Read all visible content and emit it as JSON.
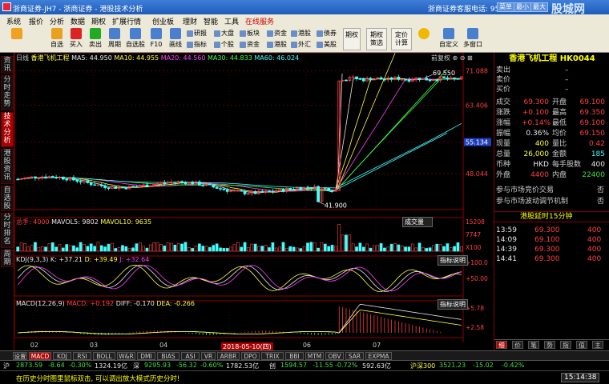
{
  "window": {
    "title": "浙商证券-JH7 - 浙商证券 - 港股技术分析",
    "phone": "浙商证券客服电话: 95345",
    "window_buttons": [
      "菜单",
      "最小",
      "最大",
      "关闭"
    ],
    "watermark": "股城网"
  },
  "menu": [
    "系统",
    "报价",
    "分析",
    "数据",
    "期权",
    "扩展行情",
    "创业板",
    "理财",
    "智能",
    "工具",
    "在线服务"
  ],
  "toolbar": {
    "large": [
      {
        "label": "",
        "icon": "back-arrow-icon",
        "color": "#f2a020"
      },
      {
        "label": "自选",
        "icon": "star-icon",
        "color": "#e8a020"
      },
      {
        "label": "买入",
        "icon": "buy-icon",
        "color": "#d22"
      },
      {
        "label": "卖出",
        "icon": "sell-icon",
        "color": "#2a2"
      },
      {
        "label": "周期",
        "icon": "period-icon",
        "color": "#4a7fd0"
      },
      {
        "label": "自选股",
        "icon": "list-icon",
        "color": "#4a7fd0"
      },
      {
        "label": "F10",
        "icon": "f10-icon",
        "color": "#4a7fd0"
      },
      {
        "label": "画线",
        "icon": "pencil-icon",
        "color": "#4a7fd0"
      }
    ],
    "small": [
      "研报",
      "指标",
      "大盘",
      "个股",
      "板块",
      "资金",
      "港股",
      "外汇",
      "债券",
      "美股"
    ],
    "boxes": [
      "期权",
      "期权\n策选",
      "定价\n计算"
    ],
    "extra": [
      "",
      "自定义",
      "多窗口"
    ]
  },
  "left_tabs": [
    "资讯",
    "分时走势",
    "技术分析",
    "港股资讯",
    "自选股",
    "分时排名",
    "周期"
  ],
  "chart_info": {
    "label": "日线",
    "name": "香港飞机工程",
    "ma_labels": [
      {
        "text": "MA5: 44.950",
        "color": "#e8e8e8"
      },
      {
        "text": "MA10: 44.955",
        "color": "#ffff40"
      },
      {
        "text": "MA20: 44.560",
        "color": "#ff40ff"
      },
      {
        "text": "MA30: 44.833",
        "color": "#40ff40"
      },
      {
        "text": "MA60: 46.024",
        "color": "#40ffff"
      }
    ],
    "right_tags": [
      "前复权",
      "⊕",
      "⊖",
      "⊠"
    ],
    "vol_labels": [
      {
        "text": "总手: 4000",
        "color": "#ff4040"
      },
      {
        "text": "MAVOL5: 9802",
        "color": "#e8e8e8"
      },
      {
        "text": "MAVOL10: 9635",
        "color": "#ffff40"
      }
    ],
    "vol_select": "成交量",
    "kdj_labels": [
      {
        "text": "KDJ(9,3,3)",
        "color": "#e8e8e8"
      },
      {
        "text": "K: +37.21",
        "color": "#e8e8e8"
      },
      {
        "text": "D: +39.49",
        "color": "#ffff40"
      },
      {
        "text": "J: +32.64",
        "color": "#ff40ff"
      }
    ],
    "macd_labels": [
      {
        "text": "MACD(12,26,9)",
        "color": "#e8e8e8"
      },
      {
        "text": "MACD: +0.192",
        "color": "#ff4040"
      },
      {
        "text": "DIFF: -0.170",
        "color": "#e8e8e8"
      },
      {
        "text": "DEA: -0.266",
        "color": "#ffff40"
      }
    ],
    "indicator_btn": "指标说明",
    "date_highlight": "2018-05-10(四)"
  },
  "chart_data": {
    "type": "candlestick",
    "x_month_labels": [
      {
        "label": "02",
        "idx": 5
      },
      {
        "label": "03",
        "idx": 22
      },
      {
        "label": "04",
        "idx": 42
      },
      {
        "label": "05",
        "idx": 61
      },
      {
        "label": "06",
        "idx": 83
      },
      {
        "label": "07",
        "idx": 103
      }
    ],
    "n": 128,
    "y_price_ticks": [
      71.088,
      63.406,
      55.134,
      48.044
    ],
    "y_price_range": [
      40.0,
      73.0
    ],
    "current_price_tag": "55.134",
    "annotations": [
      {
        "text": "69.550",
        "idx": 117,
        "price": 69.55
      },
      {
        "text": "41.900",
        "idx": 86,
        "price": 41.9
      }
    ],
    "price_start": 46.8,
    "price_drop_low": 41.9,
    "price_jump_idx": 92,
    "price_after": 69.3,
    "volume_ticks": [
      "15208",
      "7747",
      "X100"
    ],
    "kdj_ticks": [
      "100.0",
      "50.00"
    ],
    "macd_ticks": [
      "5.78",
      "2.58"
    ]
  },
  "quote": {
    "title": "香港飞机工程  HK0044",
    "bids": [
      {
        "l": "卖出",
        "v": "–"
      },
      {
        "l": "卖价",
        "v": "–"
      },
      {
        "l": "买价",
        "v": "–"
      }
    ],
    "rows": [
      {
        "l1": "成交",
        "v1": "69.300",
        "c1": "#ff4040",
        "l2": "开盘",
        "v2": "69.100",
        "c2": "#ff4040"
      },
      {
        "l1": "涨跌",
        "v1": "+0.100",
        "c1": "#ff4040",
        "l2": "最高",
        "v2": "69.350",
        "c2": "#ff4040"
      },
      {
        "l1": "涨幅",
        "v1": "+0.14%",
        "c1": "#ff4040",
        "l2": "最低",
        "v2": "69.100",
        "c2": "#ff4040"
      },
      {
        "l1": "振幅",
        "v1": "0.36%",
        "c1": "#e8e8e8",
        "l2": "均价",
        "v2": "69.150",
        "c2": "#ff4040"
      },
      {
        "l1": "现量",
        "v1": "400",
        "c1": "#ffff40",
        "l2": "量比",
        "v2": "0.42",
        "c2": "#ff4040"
      },
      {
        "l1": "总量",
        "v1": "26,000",
        "c1": "#ffff40",
        "l2": "金额",
        "v2": "185",
        "c2": "#40ffff"
      },
      {
        "l1": "币种",
        "v1": "HKD",
        "c1": "#e8e8e8",
        "l2": "每手股数",
        "v2": "400",
        "c2": "#e8e8e8"
      },
      {
        "l1": "外盘",
        "v1": "4400",
        "c1": "#ff4040",
        "l2": "内盘",
        "v2": "22400",
        "c2": "#3fe03f"
      }
    ],
    "flags": [
      {
        "l": "参与市场竞价交易",
        "v": "否"
      },
      {
        "l": "参与市场波动调节机制",
        "v": "否"
      }
    ],
    "delay_title": "港股延时15分钟",
    "trades": [
      {
        "t": "13:59",
        "p": "69.300",
        "v": "400"
      },
      {
        "t": "14:09",
        "p": "69.100",
        "v": "400"
      },
      {
        "t": "14:39",
        "p": "69.300",
        "v": "400"
      },
      {
        "t": "14:41",
        "p": "69.300",
        "v": "400"
      }
    ],
    "bottom_tabs": [
      "细",
      "价",
      "笔",
      "势",
      "指",
      "值",
      "主"
    ]
  },
  "bottom_tabs": [
    "设置",
    "MACD",
    "KDJ",
    "RSI",
    "BOLL",
    "W&R",
    "DMI",
    "BIAS",
    "ASI",
    "VR",
    "ARBR",
    "DPO",
    "TRIX",
    "BBI",
    "MTM",
    "OBV",
    "SAR",
    "EXPMA"
  ],
  "indexbar": [
    {
      "t": "沪",
      "c": "#e8e8e8"
    },
    {
      "t": "2873.59",
      "c": "#3fe03f"
    },
    {
      "t": "-8.64",
      "c": "#3fe03f"
    },
    {
      "t": "-0.30%",
      "c": "#3fe03f"
    },
    {
      "t": "1324.19亿",
      "c": "#e8e8e8"
    },
    {
      "t": "深",
      "c": "#e8e8e8"
    },
    {
      "t": "9295.93",
      "c": "#3fe03f"
    },
    {
      "t": "-56.32",
      "c": "#3fe03f"
    },
    {
      "t": "-0.60%",
      "c": "#3fe03f"
    },
    {
      "t": "1782.53亿",
      "c": "#e8e8e8"
    },
    {
      "t": "创",
      "c": "#e8e8e8"
    },
    {
      "t": "1594.57",
      "c": "#3fe03f"
    },
    {
      "t": "-11.55",
      "c": "#3fe03f"
    },
    {
      "t": "-0.72%",
      "c": "#3fe03f"
    },
    {
      "t": "592.63亿",
      "c": "#e8e8e8"
    },
    {
      "t": "沪深300",
      "c": "#ffff40"
    },
    {
      "t": "3521.23",
      "c": "#3fe03f"
    },
    {
      "t": "-15.02",
      "c": "#3fe03f"
    },
    {
      "t": "-0.42%",
      "c": "#3fe03f"
    }
  ],
  "status": {
    "ticker": "在历史分时图里鼠标双击, 可以调出放大模式历史分时!",
    "clock": "15:14:38"
  }
}
